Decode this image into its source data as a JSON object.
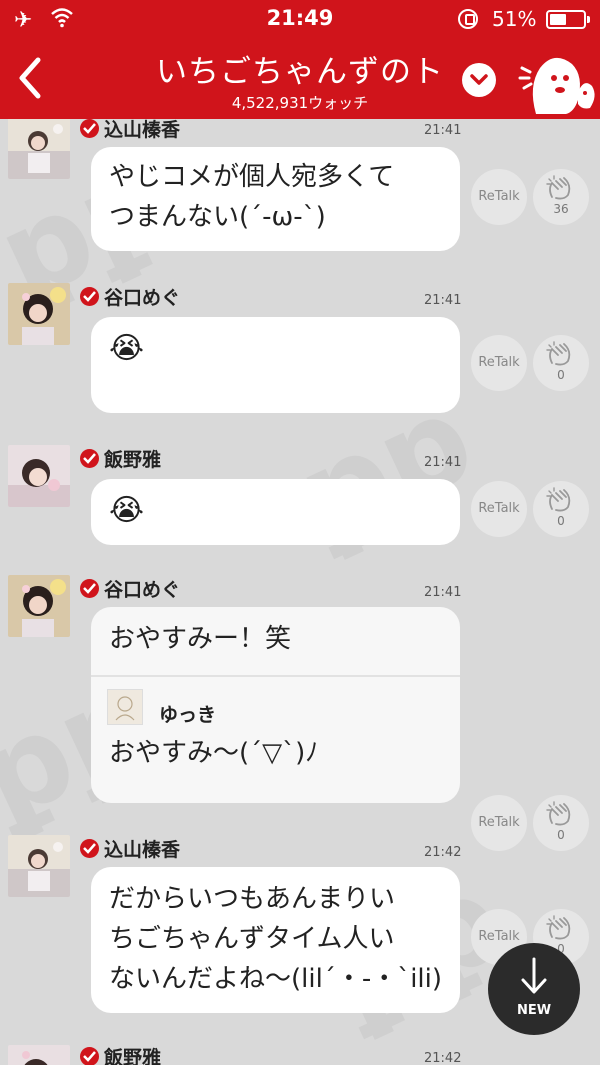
{
  "status_bar": {
    "time": "21:49",
    "battery_percent": "51%",
    "battery_level": 0.51
  },
  "header": {
    "title": "いちごちゃんずのト",
    "watch_count": "4,522,931ウォッチ"
  },
  "colors": {
    "brand_red": "#d0141b",
    "bubble_bg": "#ffffff",
    "feed_bg": "#d9d9d9",
    "new_button_bg": "#2b2b2b"
  },
  "retalk_label": "ReTalk",
  "new_button_label": "NEW",
  "messages": [
    {
      "name": "込山榛香",
      "time": "21:41",
      "text": [
        "やじコメが個人宛多くて",
        "つまんない(´-ω-`)"
      ],
      "claps": "36",
      "avatar_icon": "girl-photo-icon"
    },
    {
      "name": "谷口めぐ",
      "time": "21:41",
      "text": [
        "😭"
      ],
      "claps": "0",
      "avatar_icon": "girl-photo-icon"
    },
    {
      "name": "飯野雅",
      "time": "21:41",
      "text": [
        "😭"
      ],
      "claps": "0",
      "avatar_icon": "girl-photo-icon"
    },
    {
      "name": "谷口めぐ",
      "time": "21:41",
      "text": [
        "おやすみー！笑"
      ],
      "claps": "0",
      "avatar_icon": "girl-photo-icon",
      "quote": {
        "name": "ゆっき",
        "text": "おやすみ〜(´▽`)ﾉ"
      }
    },
    {
      "name": "込山榛香",
      "time": "21:42",
      "text": [
        "だからいつもあんまりい",
        "ちごちゃんずタイム人い",
        "ないんだよね〜(lil´・-・`ili)"
      ],
      "claps": "0",
      "avatar_icon": "girl-photo-icon"
    },
    {
      "name": "飯野雅",
      "time": "21:42",
      "text": [],
      "claps": "",
      "avatar_icon": "girl-photo-icon"
    }
  ]
}
